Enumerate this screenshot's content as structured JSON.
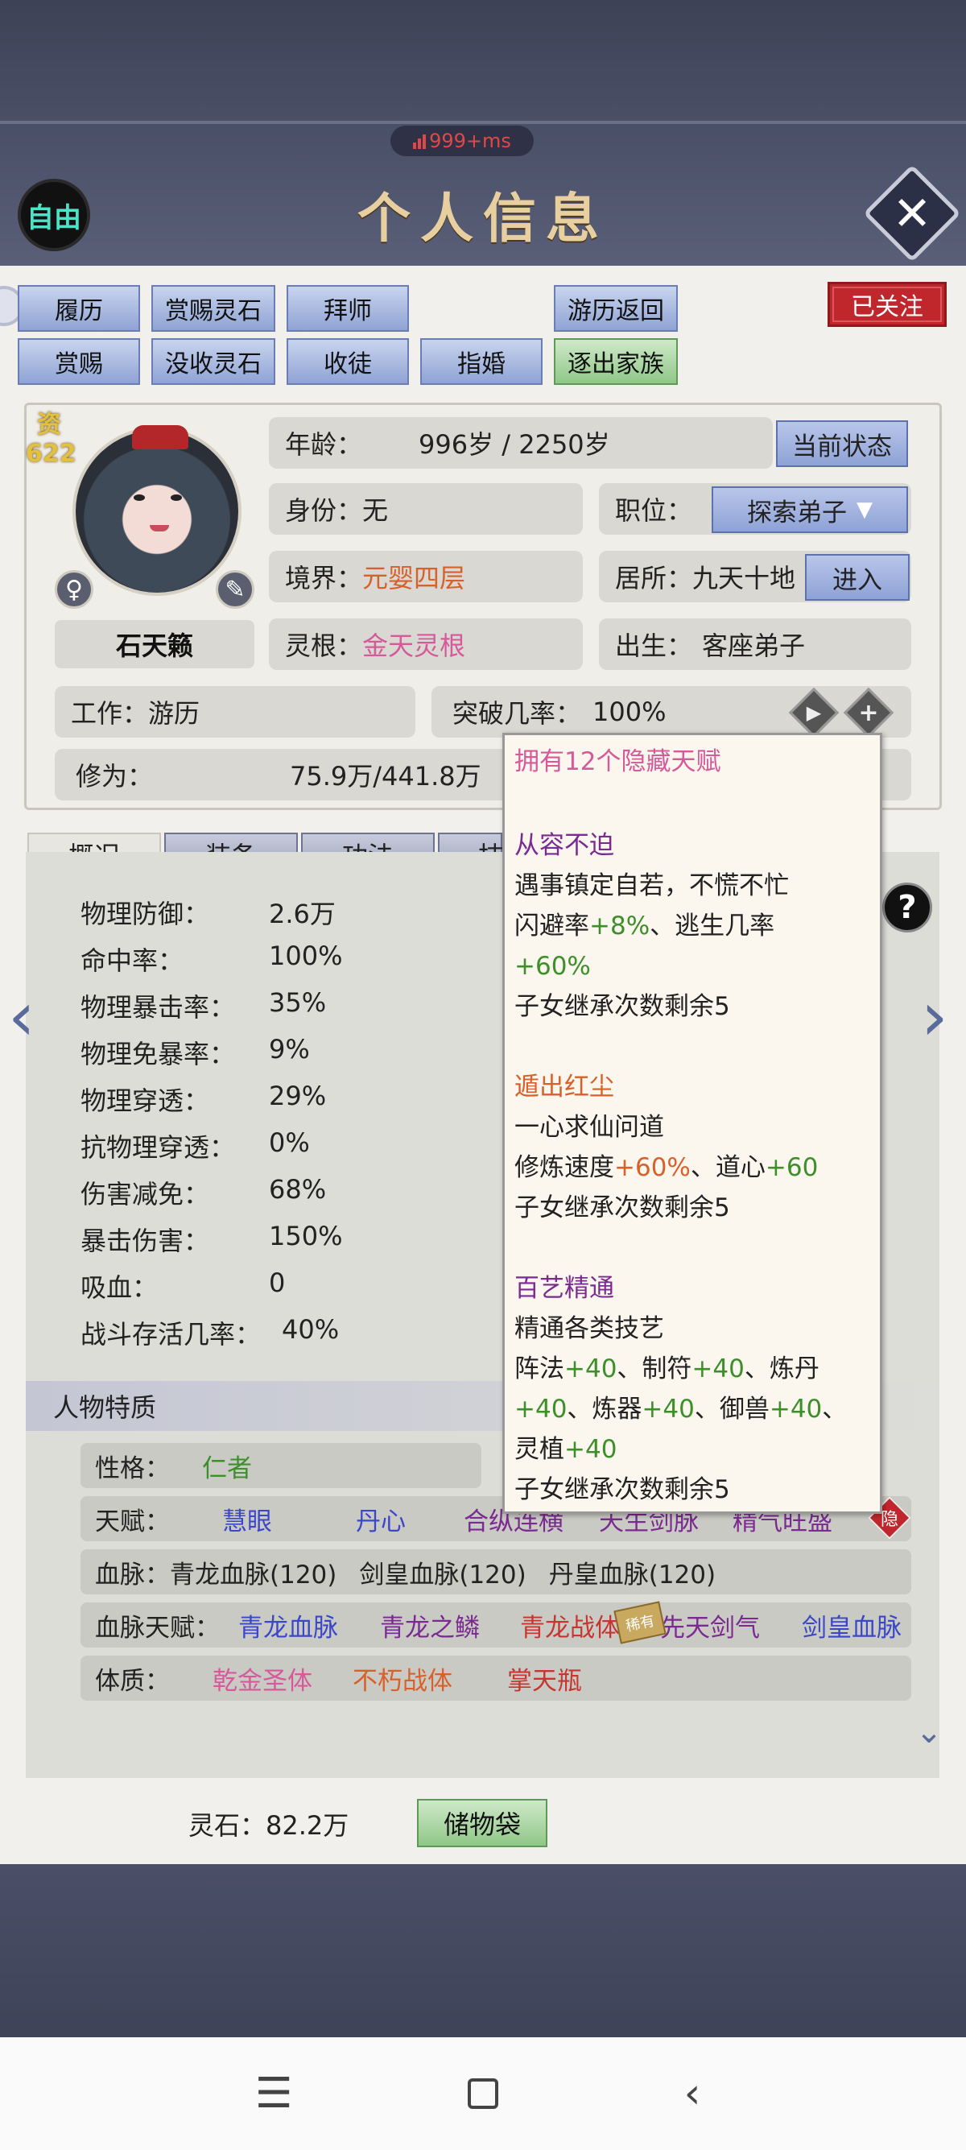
{
  "status": {
    "ping": "999+ms"
  },
  "header": {
    "free_label": "自由",
    "title": "个人信息",
    "close_icon": "close-icon"
  },
  "actions": {
    "row1": [
      "履历",
      "赏赐灵石",
      "拜师",
      "游历返回"
    ],
    "row2": [
      "赏赐",
      "没收灵石",
      "收徒",
      "指婚",
      "逐出家族"
    ],
    "follow": "已关注"
  },
  "profile": {
    "aptitude_label": "资",
    "aptitude_value": "622",
    "name": "石天籁",
    "gender_icon": "female-icon",
    "age_label": "年龄：",
    "age_value": "996岁 / 2250岁",
    "status_button": "当前状态",
    "identity_label": "身份：",
    "identity_value": "无",
    "position_label": "职位：",
    "position_value": "探索弟子",
    "realm_label": "境界：",
    "realm_value": "元婴四层",
    "residence_label": "居所：",
    "residence_value": "九天十地",
    "enter_button": "进入",
    "root_label": "灵根：",
    "root_value": "金天灵根",
    "birth_label": "出生：",
    "birth_value": "客座弟子",
    "work_label": "工作：",
    "work_value": "游历",
    "breakthrough_label": "突破几率：",
    "breakthrough_value": "100%",
    "cultivation_label": "修为：",
    "cultivation_value": "75.9万/441.8万"
  },
  "tabs": [
    "概况",
    "装备",
    "功法",
    "技"
  ],
  "stats": [
    {
      "label": "物理防御：",
      "value": "2.6万"
    },
    {
      "label": "命中率：",
      "value": "100%"
    },
    {
      "label": "物理暴击率：",
      "value": "35%"
    },
    {
      "label": "物理免暴率：",
      "value": "9%"
    },
    {
      "label": "物理穿透：",
      "value": "29%"
    },
    {
      "label": "抗物理穿透：",
      "value": "0%"
    },
    {
      "label": "伤害减免：",
      "value": "68%"
    },
    {
      "label": "暴击伤害：",
      "value": "150%"
    },
    {
      "label": "吸血：",
      "value": "0"
    },
    {
      "label": "战斗存活几率：",
      "value": "40%"
    }
  ],
  "traits": {
    "heading": "人物特质",
    "personality_label": "性格：",
    "personality_value": "仁者",
    "talent_label": "天赋：",
    "talents": [
      "慧眼",
      "丹心",
      "合纵连横",
      "天生剑脉",
      "精气旺盛"
    ],
    "hidden_badge": "隐",
    "bloodline_label": "血脉：",
    "bloodlines": [
      "青龙血脉(120)",
      "剑皇血脉(120)",
      "丹皇血脉(120)"
    ],
    "blood_talent_label": "血脉天赋：",
    "blood_talents": [
      "青龙血脉",
      "青龙之鳞",
      "青龙战体",
      "先天剑气",
      "剑皇血脉"
    ],
    "rare_badge": "稀有",
    "physique_label": "体质：",
    "physiques": [
      "乾金圣体",
      "不朽战体",
      "掌天瓶"
    ]
  },
  "footer": {
    "spirit_stone": "灵石：82.2万",
    "bag_button": "储物袋"
  },
  "popup": {
    "header": "拥有12个隐藏天赋",
    "t1_name": "从容不迫",
    "t1_l1": "遇事镇定自若，不慌不忙",
    "t1_l2a": "闪避率",
    "t1_l2b": "+8%",
    "t1_l2c": "、逃生几率",
    "t1_l3": "+60%",
    "t1_l4": "子女继承次数剩余5",
    "t2_name": "遁出红尘",
    "t2_l1": "一心求仙问道",
    "t2_l2a": "修炼速度",
    "t2_l2b": "+60%",
    "t2_l2c": "、道心",
    "t2_l2d": "+60",
    "t2_l3": "子女继承次数剩余5",
    "t3_name": "百艺精通",
    "t3_l1": "精通各类技艺",
    "t3_l2a": "阵法",
    "t3_l2b": "+40",
    "t3_l2c": "、制符",
    "t3_l2d": "+40",
    "t3_l2e": "、炼丹",
    "t3_l3a": "+40",
    "t3_l3b": "、炼器",
    "t3_l3c": "+40",
    "t3_l3d": "、御兽",
    "t3_l3e": "+40",
    "t3_l3f": "、",
    "t3_l4a": "灵植",
    "t3_l4b": "+40",
    "t3_l5": "子女继承次数剩余5"
  },
  "colors": {
    "accent_red": "#c0272d",
    "talent_blue": "#3b47c9",
    "realm_orange": "#d8602a",
    "pink": "#d65a9a",
    "green": "#3d8f2a"
  }
}
